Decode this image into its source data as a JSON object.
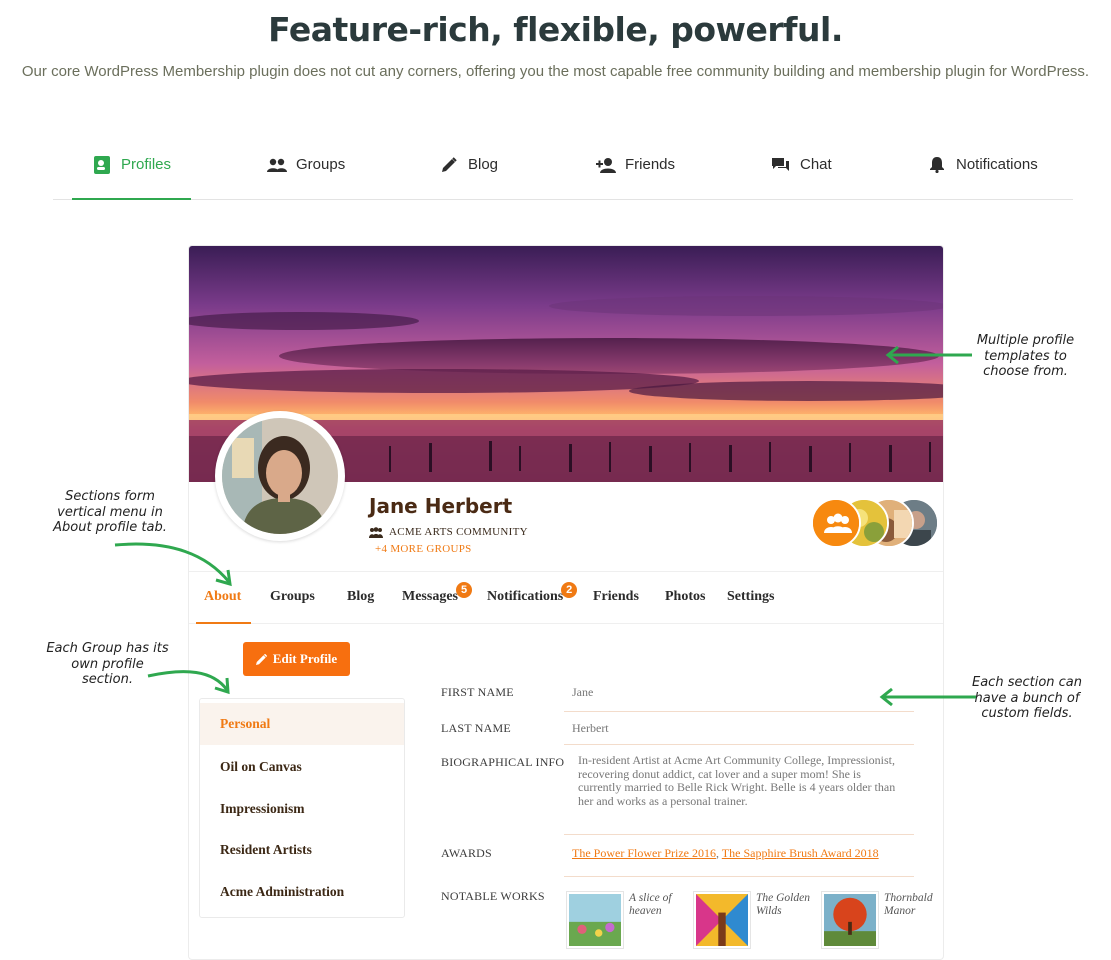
{
  "headline": "Feature-rich, flexible, powerful.",
  "subline": "Our core WordPress Membership plugin does not cut any corners, offering you the most capable free community building and membership plugin for WordPress.",
  "feature_tabs": [
    {
      "label": "Profiles",
      "icon": "profile-card-icon",
      "active": true
    },
    {
      "label": "Groups",
      "icon": "users-icon",
      "active": false
    },
    {
      "label": "Blog",
      "icon": "pencil-icon",
      "active": false
    },
    {
      "label": "Friends",
      "icon": "add-user-icon",
      "active": false
    },
    {
      "label": "Chat",
      "icon": "chat-icon",
      "active": false
    },
    {
      "label": "Notifications",
      "icon": "bell-icon",
      "active": false
    }
  ],
  "profile": {
    "name": "Jane Herbert",
    "group": "ACME ARTS COMMUNITY",
    "more_groups": "+4 MORE GROUPS"
  },
  "profile_tabs": [
    {
      "label": "About",
      "active": true
    },
    {
      "label": "Groups"
    },
    {
      "label": "Blog"
    },
    {
      "label": "Messages",
      "badge": "5"
    },
    {
      "label": "Notifications",
      "badge": "2"
    },
    {
      "label": "Friends"
    },
    {
      "label": "Photos"
    },
    {
      "label": "Settings"
    }
  ],
  "edit_profile_label": "Edit Profile",
  "sections": [
    {
      "label": "Personal",
      "active": true
    },
    {
      "label": "Oil on Canvas"
    },
    {
      "label": "Impressionism"
    },
    {
      "label": "Resident Artists"
    },
    {
      "label": "Acme Administration"
    }
  ],
  "fields": {
    "first_name_label": "FIRST NAME",
    "first_name": "Jane",
    "last_name_label": "LAST NAME",
    "last_name": "Herbert",
    "bio_label": "BIOGRAPHICAL INFO",
    "bio": "In-resident Artist at Acme Art Community College, Impressionist, recovering donut addict, cat lover and a super mom! She is currently married to Belle Rick Wright. Belle is 4 years older than her and works as a personal trainer.",
    "awards_label": "AWARDS",
    "award_1": "The Power Flower Prize 2016",
    "award_sep": ",",
    "award_2": "The Sapphire Brush Award 2018",
    "works_label": "NOTABLE WORKS",
    "works": [
      {
        "title": "A slice of heaven"
      },
      {
        "title": "The Golden Wilds"
      },
      {
        "title": "Thornbald Manor"
      }
    ]
  },
  "annotations": {
    "templates": "Multiple profile templates to choose from.",
    "sections_menu": "Sections form vertical menu in About profile tab.",
    "group_section": "Each Group has its own profile section.",
    "custom_fields": "Each section can have a bunch of custom fields."
  },
  "colors": {
    "accent_green": "#2fa84f",
    "accent_orange": "#f07a14"
  }
}
